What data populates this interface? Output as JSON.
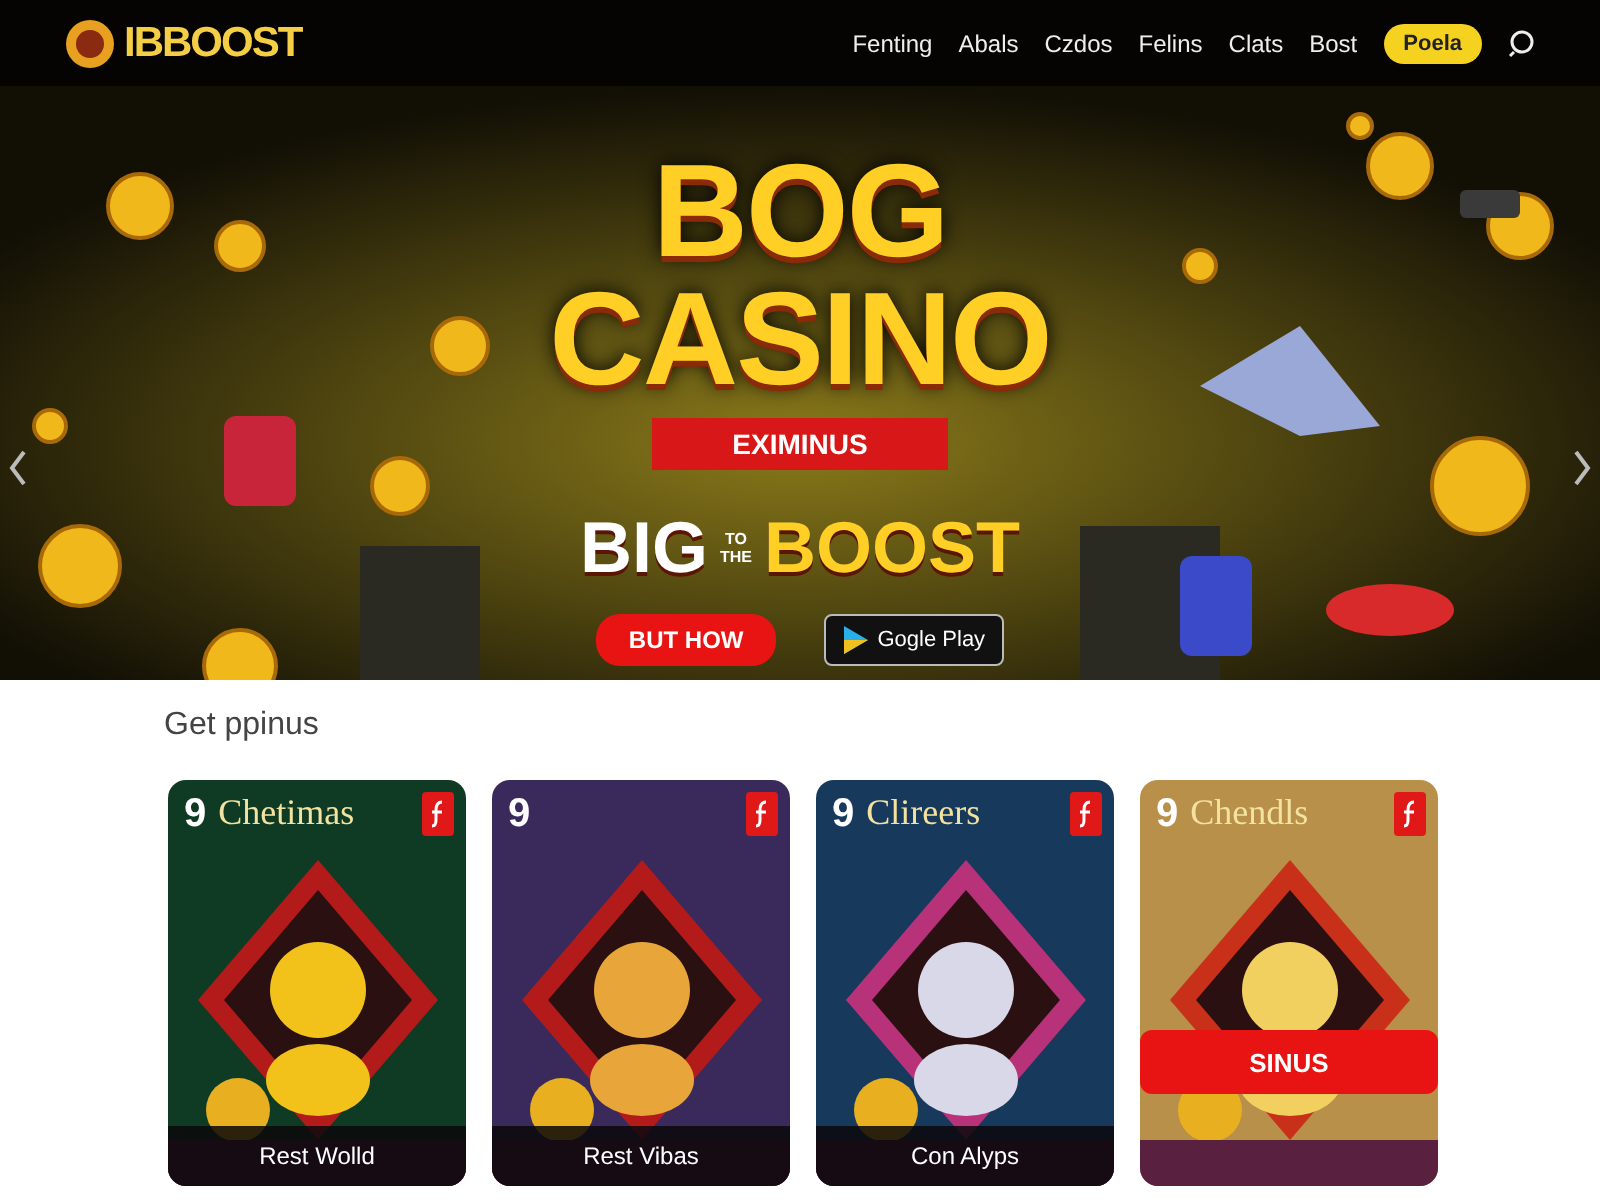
{
  "nav": {
    "logo": "IBBOOST",
    "links": [
      "Fenting",
      "Abals",
      "Czdos",
      "Felins",
      "Clats",
      "Bost"
    ],
    "cta": "Poela"
  },
  "hero": {
    "title_lines": [
      "BOG",
      "CASINO"
    ],
    "ribbon": "EXIMINUS",
    "tagline": {
      "first": "BIG",
      "small": "TO THE",
      "last": "BOOST"
    },
    "primary_button": "BUT HOW",
    "store_badge": "Gogle Play"
  },
  "section": {
    "heading": "Get ppinus"
  },
  "cards": [
    {
      "number": "9",
      "title": "Chetimas",
      "footer": "Rest Wolld",
      "kind": "label"
    },
    {
      "number": "9",
      "footer": "Rest Vibas",
      "kind": "label"
    },
    {
      "number": "9",
      "title": "Clireers",
      "footer": "Con Alyps",
      "kind": "label"
    },
    {
      "number": "9",
      "title": "Chendls",
      "footer": "SINUS",
      "kind": "button"
    }
  ]
}
